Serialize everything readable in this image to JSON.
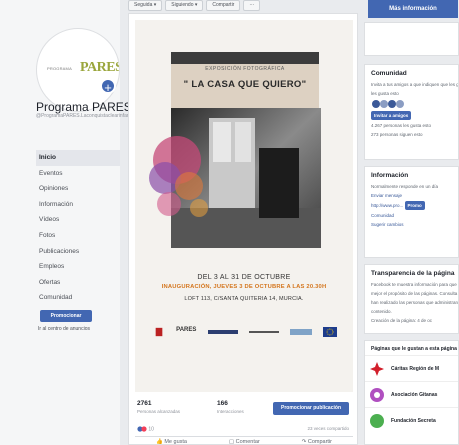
{
  "topbar": {
    "buttons": [
      "Seguida ▾",
      "Siguiendo ▾",
      "Compartir",
      "···"
    ]
  },
  "page": {
    "logo_small": "PROGRAMA",
    "logo_big": "PARES",
    "name": "Programa PARES",
    "handle": "@ProgramaPARES.Laconquistaclearinfanfamilialconexclusion"
  },
  "nav": {
    "items": [
      "Inicio",
      "Eventos",
      "Opiniones",
      "Información",
      "Vídeos",
      "Fotos",
      "Publicaciones",
      "Empleos",
      "Ofertas",
      "Comunidad"
    ],
    "promote": "Promocionar",
    "ads_center": "Ir al centro de anuncios"
  },
  "poster": {
    "subtitle": "EXPOSICIÓN FOTOGRÁFICA",
    "title": "\" LA CASA QUE QUIERO\"",
    "dates": "DEL 3 AL 31 DE OCTUBRE",
    "inauguration": "INAUGURACIÓN, JUEVES 3 DE OCTUBRE A LAS 20.30H",
    "location": "LOFT 113, C/SANTA QUITERIA 14, MURCIA.",
    "sponsors": [
      "",
      "PARES",
      "",
      "",
      ""
    ]
  },
  "post": {
    "reached_count": "2761",
    "reached_label": "Personas alcanzadas",
    "interactions_count": "166",
    "interactions_label": "Interacciones",
    "promote_post": "Promocionar publicación",
    "reactions_count": "10",
    "comments_count": "23 veces compartido",
    "actions": [
      "Me gusta",
      "Comentar",
      "Compartir"
    ]
  },
  "sidebar": {
    "top_button": "Más información",
    "community_title": "Comunidad",
    "community_lines": [
      "Invita a tus amigos a que indiquen que les gusta esta",
      "les gusta esto",
      "4.267 personas les gusta esto",
      "273 personas siguen esto"
    ],
    "invite_button": "Invitar a amigos",
    "info_title": "Información",
    "info_lines": [
      "Normalmente responde en un día",
      "Enviar mensaje",
      "http://www.pro...",
      "Comunidad",
      "Sugerir cambios"
    ],
    "info_button": "Promo",
    "transparency_title": "Transparencia de la página",
    "transparency_lines": [
      "Facebook te muestra información para que",
      "mejor el propósito de las páginas. Consulta",
      "han realizado las personas que administran",
      "contenido.",
      "Creación de la página: 4 de oc"
    ],
    "liked_pages_title": "Páginas que le gustan a esta página",
    "liked_pages": [
      "Cáritas Región de M",
      "Asociación Gitanas",
      "Fundación Secreta"
    ]
  },
  "colors": {
    "fb_blue": "#4267b2",
    "accent_orange": "#d4761e",
    "background": "#e9ebee"
  }
}
